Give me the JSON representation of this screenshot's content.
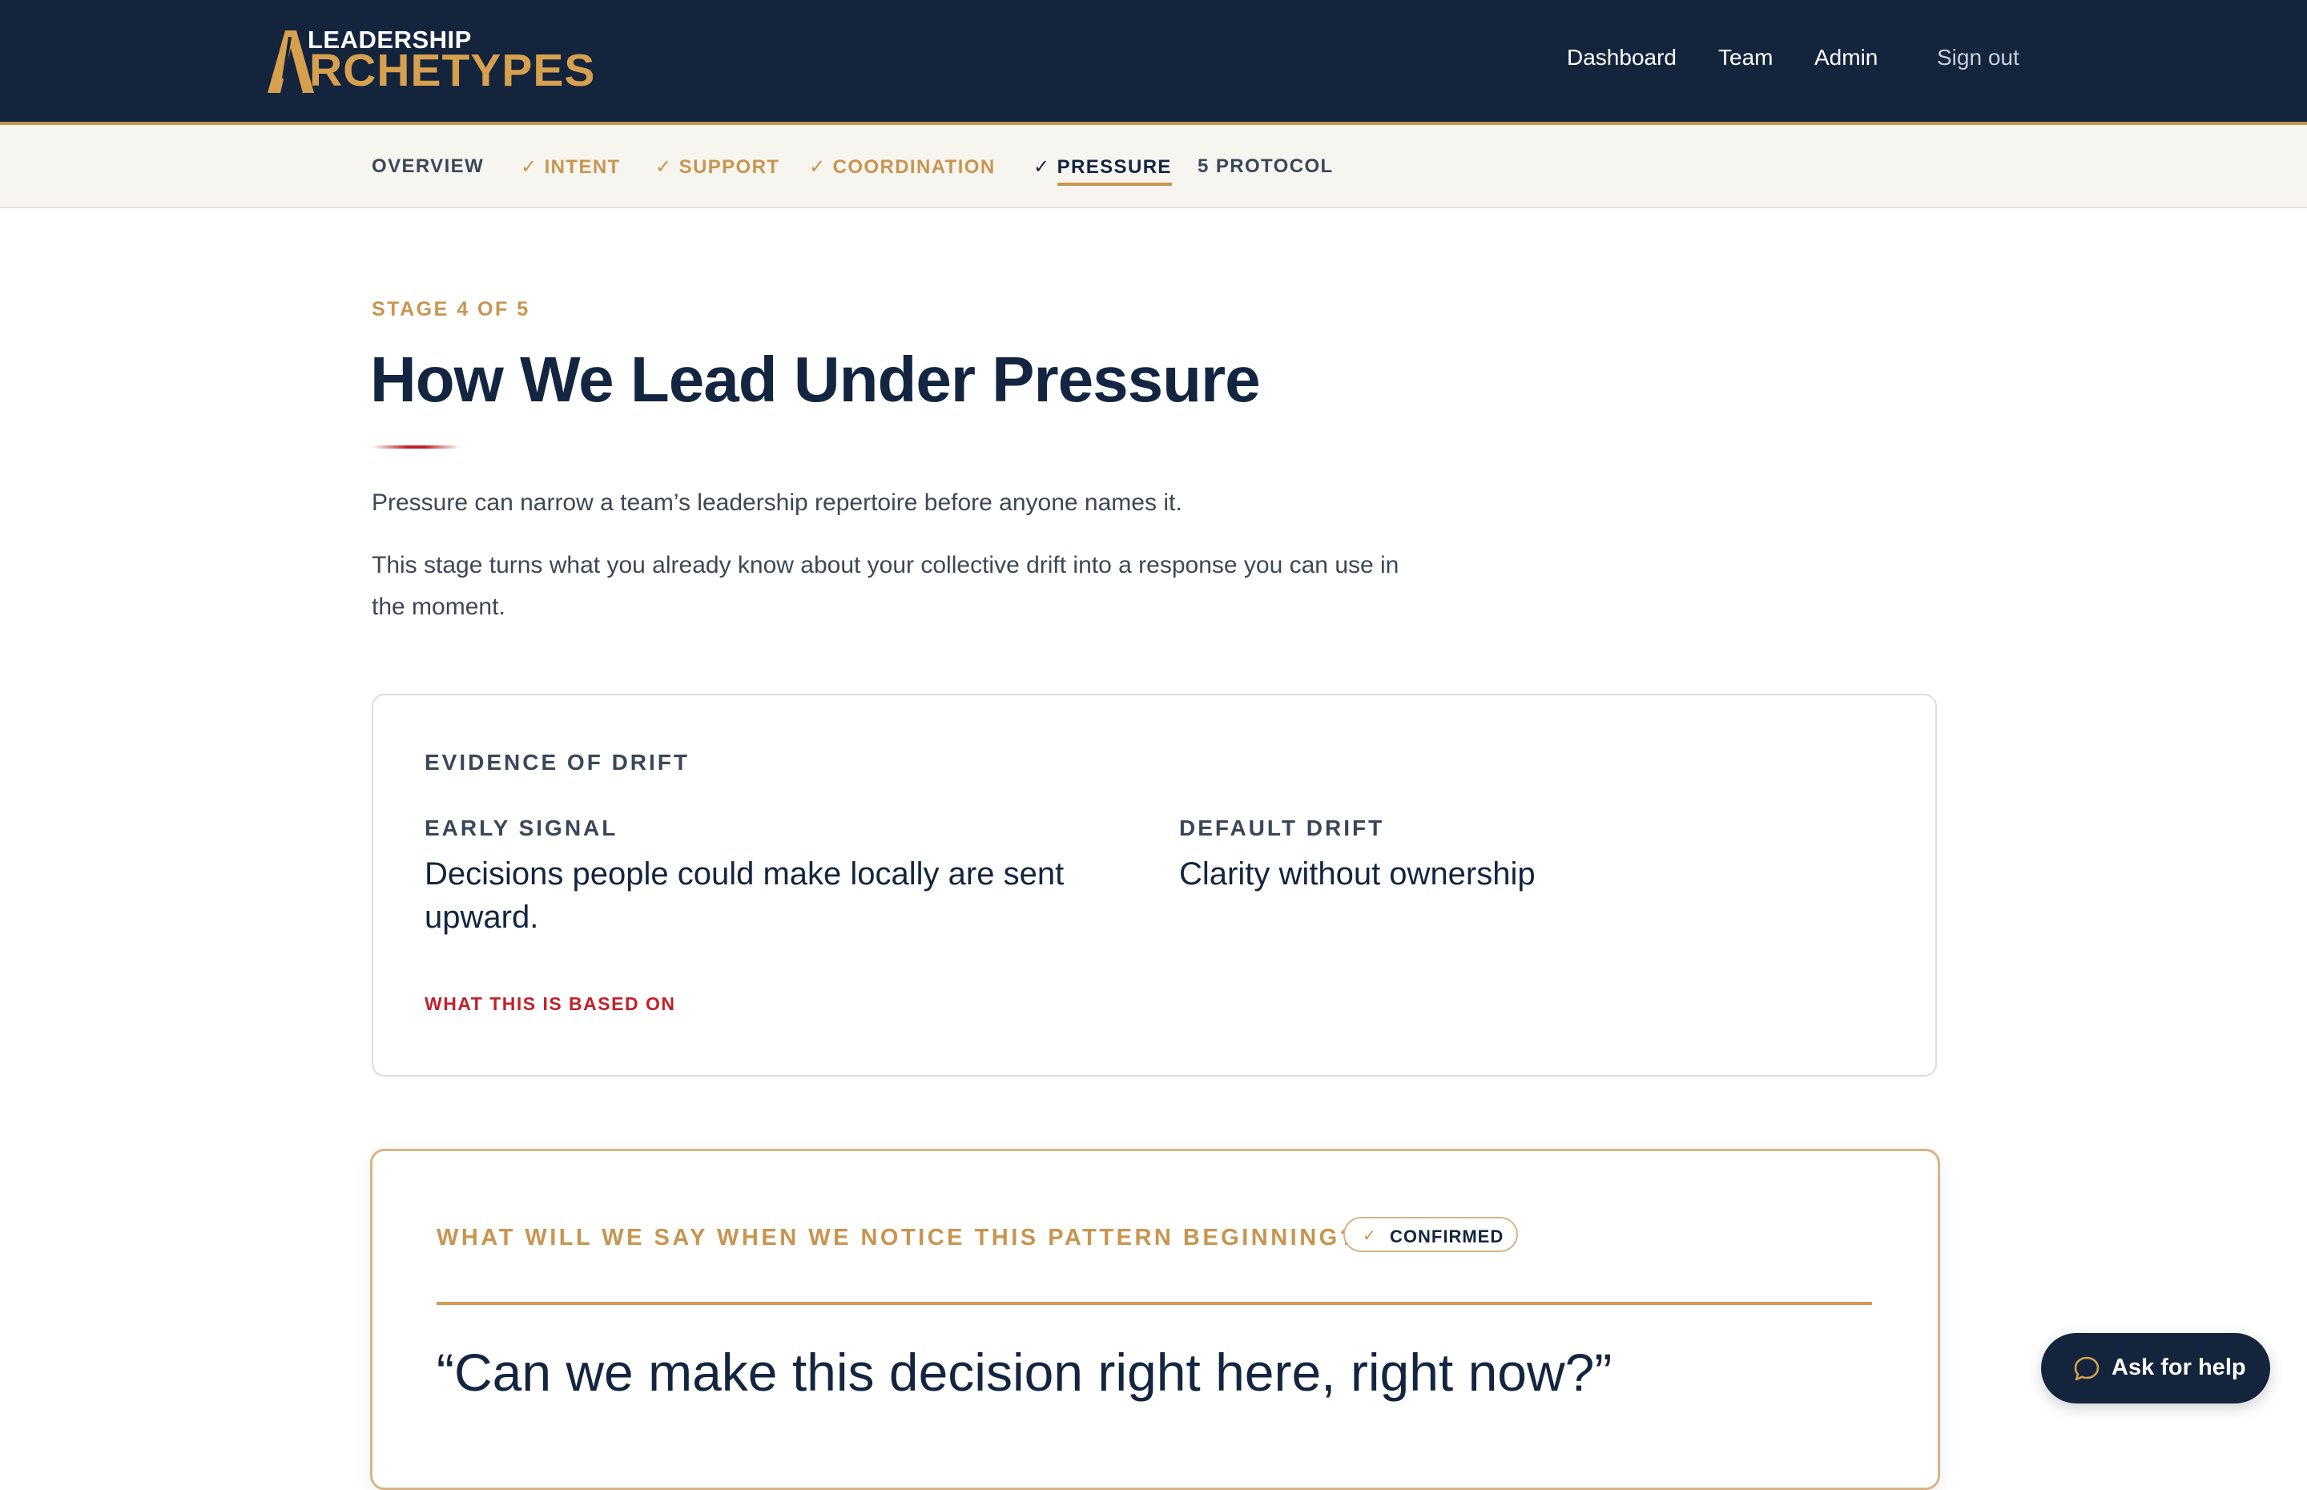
{
  "brand": {
    "line1": "LEADERSHIP",
    "line2_rest": "RCHETYPES",
    "colors": {
      "navy": "#14243d",
      "gold": "#c8954f",
      "red": "#c02228"
    }
  },
  "nav": {
    "items": [
      "Dashboard",
      "Team",
      "Admin"
    ],
    "signout": "Sign out"
  },
  "stepper": {
    "steps": [
      {
        "label": "OVERVIEW",
        "state": "plain",
        "prefix": ""
      },
      {
        "label": "INTENT",
        "state": "done",
        "prefix": "✓"
      },
      {
        "label": "SUPPORT",
        "state": "done",
        "prefix": "✓"
      },
      {
        "label": "COORDINATION",
        "state": "done",
        "prefix": "✓"
      },
      {
        "label": "PRESSURE",
        "state": "active",
        "prefix": "✓"
      },
      {
        "label": "PROTOCOL",
        "state": "plain",
        "prefix": "5"
      }
    ]
  },
  "header": {
    "eyebrow": "STAGE 4 OF 5",
    "title": "How We Lead Under Pressure",
    "intro1": "Pressure can narrow a team’s leadership repertoire before anyone names it.",
    "intro2_line1": "This stage turns what you already know about your collective drift into a response you can use in",
    "intro2_line2": "the moment."
  },
  "evidence": {
    "eyebrow": "EVIDENCE OF DRIFT",
    "early_signal_label": "EARLY SIGNAL",
    "early_signal_line1": "Decisions people could make locally are sent",
    "early_signal_line2": "upward.",
    "default_drift_label": "DEFAULT DRIFT",
    "default_drift_value": "Clarity without ownership",
    "based_on_link": "WHAT THIS IS BASED ON"
  },
  "question": {
    "eyebrow": "WHAT WILL WE SAY WHEN WE NOTICE THIS PATTERN BEGINNING?",
    "badge": "CONFIRMED",
    "answer": "“Can we make this decision right here, right now?”"
  },
  "help": {
    "label": "Ask for help",
    "icon": "chat-bubble-icon"
  }
}
